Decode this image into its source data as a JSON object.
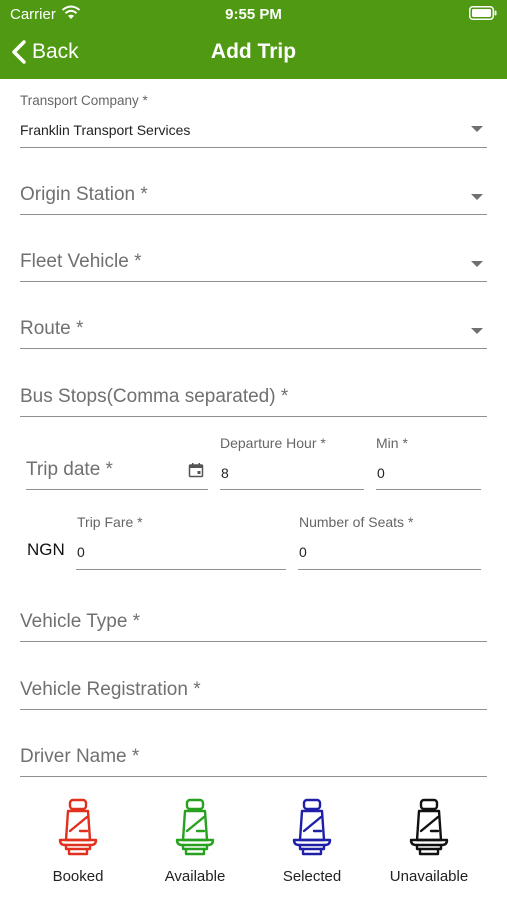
{
  "status": {
    "carrier": "Carrier",
    "time": "9:55 PM"
  },
  "nav": {
    "back_label": "Back",
    "title": "Add Trip"
  },
  "form": {
    "transport_company": {
      "label": "Transport Company *",
      "value": "Franklin Transport Services"
    },
    "origin_station": {
      "placeholder": "Origin Station *"
    },
    "fleet_vehicle": {
      "placeholder": "Fleet Vehicle *"
    },
    "route": {
      "placeholder": "Route *"
    },
    "bus_stops": {
      "placeholder": "Bus Stops(Comma separated) *"
    },
    "trip_date": {
      "placeholder": "Trip date *"
    },
    "departure_hour": {
      "label": "Departure Hour *",
      "value": "8"
    },
    "minute": {
      "label": "Min *",
      "value": "0"
    },
    "trip_fare": {
      "label": "Trip Fare *",
      "currency": "NGN",
      "value": "0"
    },
    "number_of_seats": {
      "label": "Number of Seats *",
      "value": "0"
    },
    "vehicle_type": {
      "placeholder": "Vehicle Type *"
    },
    "vehicle_registration": {
      "placeholder": "Vehicle Registration *"
    },
    "driver_name": {
      "placeholder": "Driver Name *"
    }
  },
  "legend": [
    {
      "label": "Booked",
      "icon": "seat-icon",
      "color": "#e0301e"
    },
    {
      "label": "Available",
      "icon": "seat-icon",
      "color": "#27a11f"
    },
    {
      "label": "Selected",
      "icon": "seat-icon",
      "color": "#1f1fa8"
    },
    {
      "label": "Unavailable",
      "icon": "seat-icon",
      "color": "#111111"
    }
  ],
  "colors": {
    "header": "#4f9a12"
  }
}
